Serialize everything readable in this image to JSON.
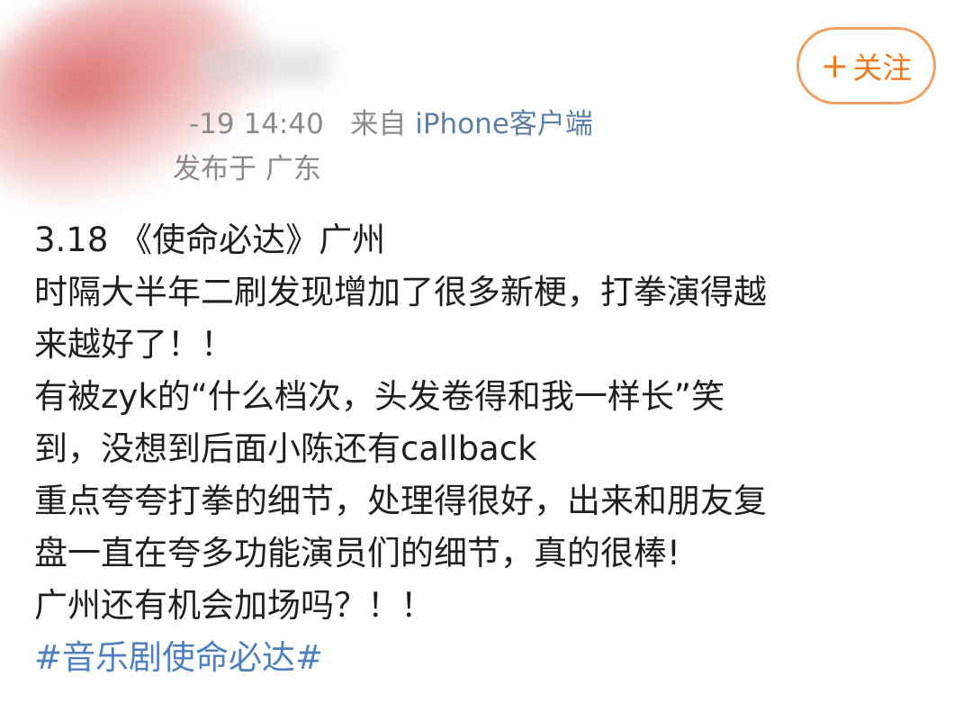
{
  "header": {
    "follow_label": "关注",
    "follow_plus": "+",
    "timestamp": "-19 14:40",
    "source_prefix": "来自",
    "source_device": "iPhone客户端",
    "location": "发布于 广东"
  },
  "post": {
    "lines": [
      "3.18 《使命必达》广州",
      "时隔大半年二刷发现增加了很多新梗，打拳演得越",
      "来越好了！！",
      "有被zyk的“什么档次，头发卷得和我一样长”笑",
      "到，没想到后面小陈还有callback",
      "重点夸夸打拳的细节，处理得很好，出来和朋友复",
      "盘一直在夸多功能演员们的细节，真的很棒!",
      "广州还有机会加场吗？！！"
    ],
    "hashtag": "#音乐剧使命必达#"
  },
  "colors": {
    "accent_orange": "#f07a1e",
    "link_blue": "#4f7fbf",
    "meta_gray": "#8a8a8a"
  }
}
